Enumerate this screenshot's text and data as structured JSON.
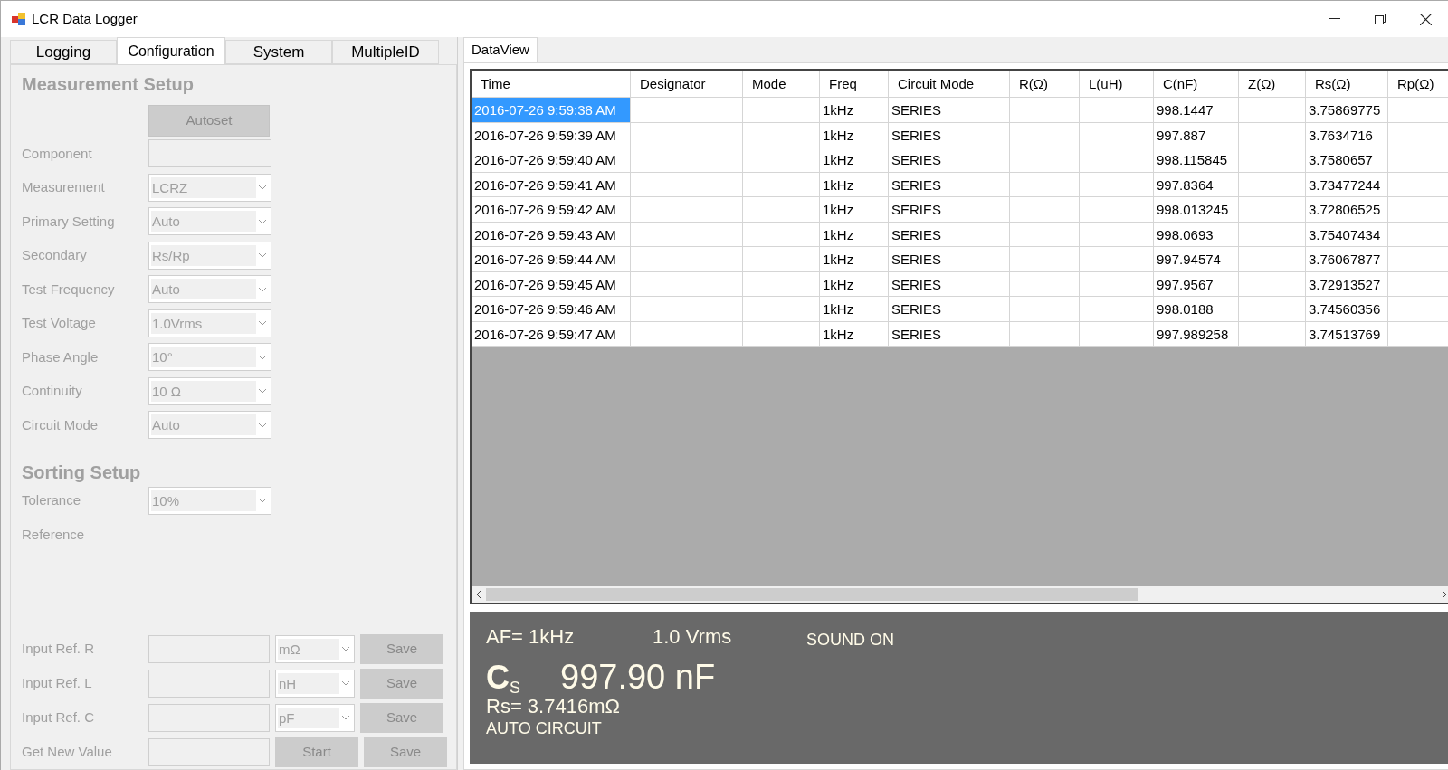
{
  "window": {
    "title": "LCR Data Logger"
  },
  "left_tabs": [
    {
      "label": "Logging",
      "selected": false
    },
    {
      "label": "Configuration",
      "selected": true
    },
    {
      "label": "System",
      "selected": false
    },
    {
      "label": "MultipleID",
      "selected": false
    }
  ],
  "measurement_setup": {
    "heading": "Measurement Setup",
    "autoset_button": "Autoset",
    "fields": [
      {
        "label": "Component",
        "kind": "textbox"
      },
      {
        "label": "Measurement",
        "kind": "dropdown",
        "value": "LCRZ"
      },
      {
        "label": "Primary Setting",
        "kind": "dropdown",
        "value": "Auto"
      },
      {
        "label": "Secondary",
        "kind": "dropdown",
        "value": "Rs/Rp"
      },
      {
        "label": "Test Frequency",
        "kind": "dropdown",
        "value": "Auto"
      },
      {
        "label": "Test Voltage",
        "kind": "dropdown",
        "value": "1.0Vrms"
      },
      {
        "label": "Phase Angle",
        "kind": "dropdown",
        "value": "10°"
      },
      {
        "label": "Continuity",
        "kind": "dropdown",
        "value": "10 Ω"
      },
      {
        "label": "Circuit Mode",
        "kind": "dropdown",
        "value": "Auto"
      }
    ]
  },
  "sorting_setup": {
    "heading": "Sorting Setup",
    "fields": [
      {
        "label": "Tolerance",
        "kind": "dropdown",
        "value": "10%"
      },
      {
        "label": "Reference",
        "kind": "none"
      }
    ]
  },
  "reference_inputs": [
    {
      "label": "Input Ref. R",
      "controls": [
        {
          "kind": "textbox"
        },
        {
          "kind": "dropdown",
          "value": "mΩ"
        },
        {
          "kind": "button",
          "label": "Save"
        }
      ]
    },
    {
      "label": "Input Ref. L",
      "controls": [
        {
          "kind": "textbox"
        },
        {
          "kind": "dropdown",
          "value": "nH"
        },
        {
          "kind": "button",
          "label": "Save"
        }
      ]
    },
    {
      "label": "Input Ref. C",
      "controls": [
        {
          "kind": "textbox"
        },
        {
          "kind": "dropdown",
          "value": "pF"
        },
        {
          "kind": "button",
          "label": "Save"
        }
      ]
    },
    {
      "label": "Get New Value",
      "controls": [
        {
          "kind": "textbox"
        },
        {
          "kind": "button",
          "label": "Start"
        },
        {
          "kind": "button",
          "label": "Save"
        }
      ]
    }
  ],
  "right_tabs": [
    {
      "label": "DataView",
      "selected": true
    }
  ],
  "table": {
    "columns": [
      "Time",
      "Designator",
      "Mode",
      "Freq",
      "Circuit Mode",
      "R(Ω)",
      "L(uH)",
      "C(nF)",
      "Z(Ω)",
      "Rs(Ω)",
      "Rp(Ω)"
    ],
    "rows": [
      {
        "selected": true,
        "cells": [
          "2016-07-26 9:59:38 AM",
          null,
          null,
          "1kHz",
          "SERIES",
          null,
          null,
          "998.1447",
          null,
          "3.75869775",
          null
        ]
      },
      {
        "selected": false,
        "cells": [
          "2016-07-26 9:59:39 AM",
          null,
          null,
          "1kHz",
          "SERIES",
          null,
          null,
          "997.887",
          null,
          "3.7634716",
          null
        ]
      },
      {
        "selected": false,
        "cells": [
          "2016-07-26 9:59:40 AM",
          null,
          null,
          "1kHz",
          "SERIES",
          null,
          null,
          "998.115845",
          null,
          "3.7580657",
          null
        ]
      },
      {
        "selected": false,
        "cells": [
          "2016-07-26 9:59:41 AM",
          null,
          null,
          "1kHz",
          "SERIES",
          null,
          null,
          "997.8364",
          null,
          "3.73477244",
          null
        ]
      },
      {
        "selected": false,
        "cells": [
          "2016-07-26 9:59:42 AM",
          null,
          null,
          "1kHz",
          "SERIES",
          null,
          null,
          "998.013245",
          null,
          "3.72806525",
          null
        ]
      },
      {
        "selected": false,
        "cells": [
          "2016-07-26 9:59:43 AM",
          null,
          null,
          "1kHz",
          "SERIES",
          null,
          null,
          "998.0693",
          null,
          "3.75407434",
          null
        ]
      },
      {
        "selected": false,
        "cells": [
          "2016-07-26 9:59:44 AM",
          null,
          null,
          "1kHz",
          "SERIES",
          null,
          null,
          "997.94574",
          null,
          "3.76067877",
          null
        ]
      },
      {
        "selected": false,
        "cells": [
          "2016-07-26 9:59:45 AM",
          null,
          null,
          "1kHz",
          "SERIES",
          null,
          null,
          "997.9567",
          null,
          "3.72913527",
          null
        ]
      },
      {
        "selected": false,
        "cells": [
          "2016-07-26 9:59:46 AM",
          null,
          null,
          "1kHz",
          "SERIES",
          null,
          null,
          "998.0188",
          null,
          "3.74560356",
          null
        ]
      },
      {
        "selected": false,
        "cells": [
          "2016-07-26 9:59:47 AM",
          null,
          null,
          "1kHz",
          "SERIES",
          null,
          null,
          "997.989258",
          null,
          "3.74513769",
          null
        ]
      }
    ]
  },
  "display": {
    "frequency": "AF= 1kHz",
    "voltage": "1.0 Vrms",
    "sound": "SOUND ON",
    "primary_label": "C$_{S}$",
    "primary_value": "997.90 nF",
    "secondary": "Rs= 3.7416mΩ",
    "circuit": "AUTO CIRCUIT"
  }
}
